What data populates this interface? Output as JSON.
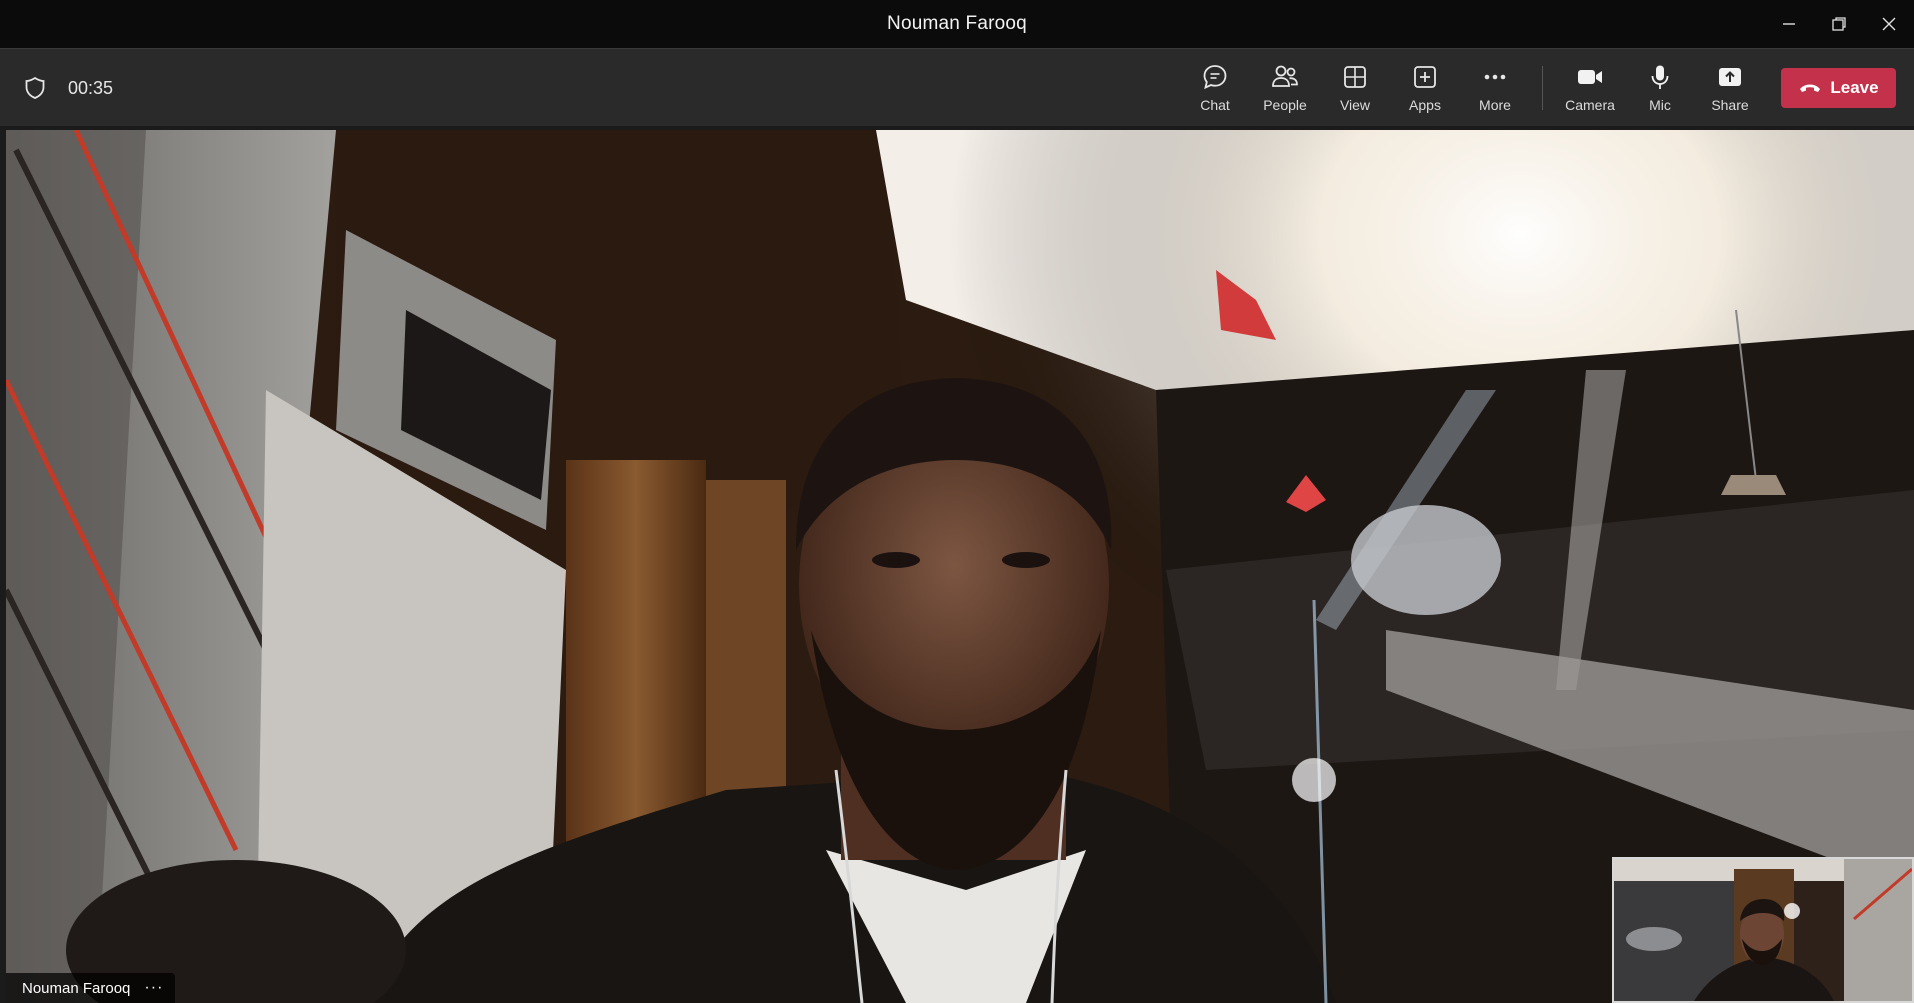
{
  "window": {
    "title": "Nouman Farooq",
    "controls": [
      "minimize-icon",
      "restore-icon",
      "close-icon"
    ]
  },
  "toolbar": {
    "timer": "00:35",
    "buttons": [
      {
        "id": "chat",
        "label": "Chat",
        "icon": "chat-icon"
      },
      {
        "id": "people",
        "label": "People",
        "icon": "people-icon"
      },
      {
        "id": "view",
        "label": "View",
        "icon": "view-grid-icon"
      },
      {
        "id": "apps",
        "label": "Apps",
        "icon": "apps-plus-icon"
      },
      {
        "id": "more",
        "label": "More",
        "icon": "more-dots-icon"
      },
      {
        "id": "camera",
        "label": "Camera",
        "icon": "camera-icon"
      },
      {
        "id": "mic",
        "label": "Mic",
        "icon": "mic-icon"
      },
      {
        "id": "share",
        "label": "Share",
        "icon": "share-icon"
      }
    ],
    "leave_label": "Leave"
  },
  "stage": {
    "participant_name": "Nouman Farooq",
    "options": "···"
  },
  "colors": {
    "leave": "#c4314b",
    "toolbar_bg": "#2a2a2a",
    "titlebar_bg": "#0b0b0b"
  }
}
